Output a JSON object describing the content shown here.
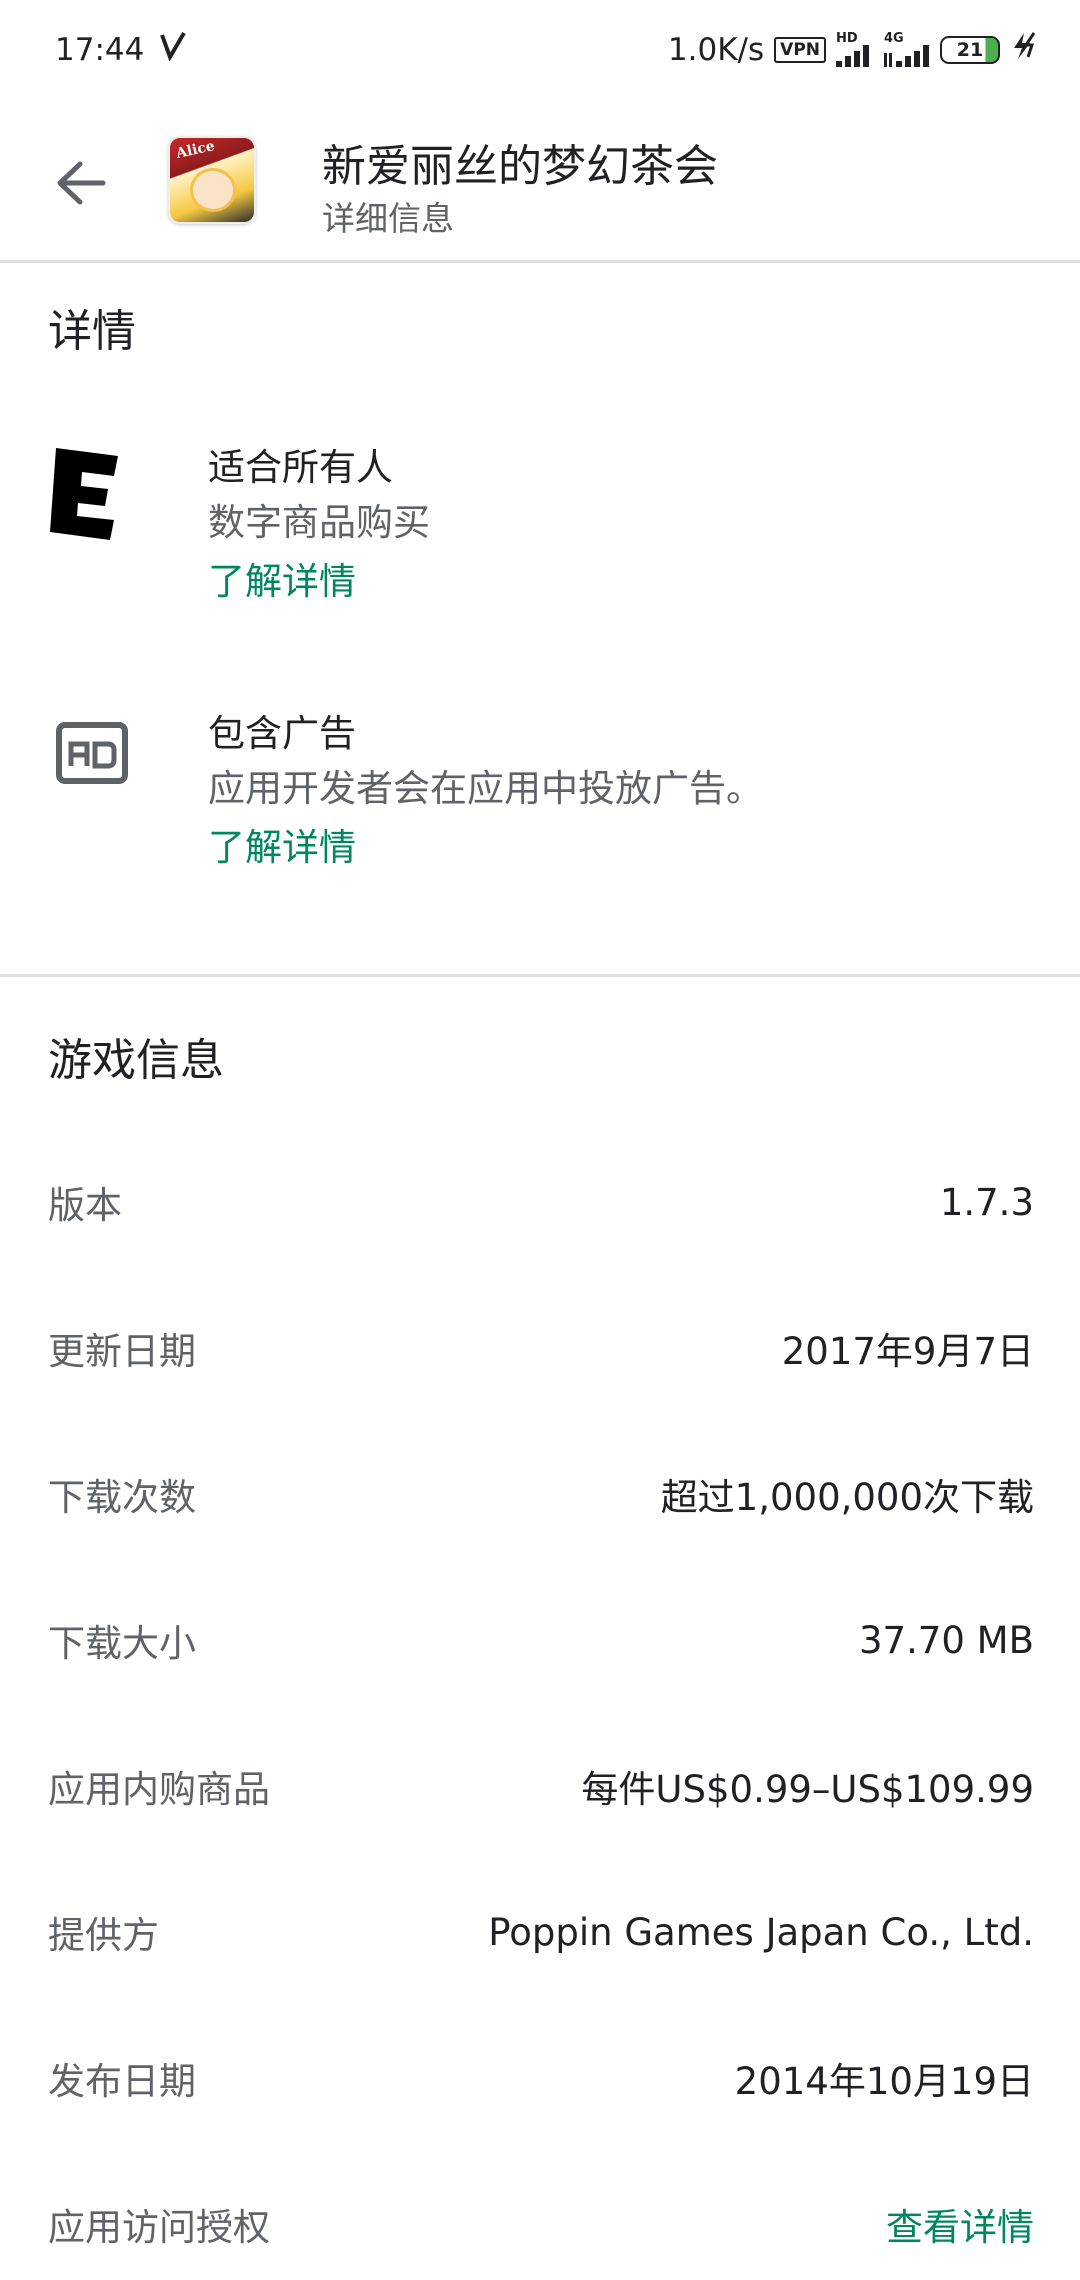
{
  "status_bar": {
    "time": "17:44",
    "net_speed": "1.0K/s",
    "vpn": "VPN",
    "hd": "HD",
    "net_type": "4G",
    "battery": "21"
  },
  "header": {
    "title": "新爱丽丝的梦幻茶会",
    "subtitle": "详细信息",
    "icon_text": "Alice"
  },
  "details": {
    "title": "详情",
    "rating": {
      "icon": "esrb-e-icon",
      "heading": "适合所有人",
      "description": "数字商品购买",
      "link": "了解详情"
    },
    "ads": {
      "icon": "ad-icon",
      "heading": "包含广告",
      "description": "应用开发者会在应用中投放广告。",
      "link": "了解详情"
    }
  },
  "game_info": {
    "title": "游戏信息",
    "rows": [
      {
        "label": "版本",
        "value": "1.7.3"
      },
      {
        "label": "更新日期",
        "value": "2017年9月7日"
      },
      {
        "label": "下载次数",
        "value": "超过1,000,000次下载"
      },
      {
        "label": "下载大小",
        "value": "37.70 MB"
      },
      {
        "label": "应用内购商品",
        "value": "每件US$0.99–US$109.99"
      },
      {
        "label": "提供方",
        "value": "Poppin Games Japan Co., Ltd."
      },
      {
        "label": "发布日期",
        "value": "2014年10月19日"
      },
      {
        "label": "应用访问授权",
        "value": "查看详情"
      }
    ]
  },
  "colors": {
    "accent": "#01875f",
    "text_primary": "#202124",
    "text_secondary": "#5f6368",
    "divider": "#e0e0e0"
  }
}
